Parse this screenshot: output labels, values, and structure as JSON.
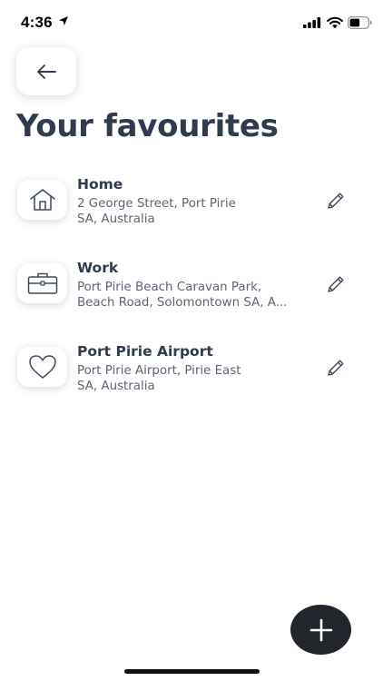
{
  "status_bar": {
    "time": "4:36"
  },
  "header": {
    "title": "Your favourites"
  },
  "favourites": [
    {
      "title": "Home",
      "icon": "home-icon",
      "address_lines": [
        "2 George Street, Port Pirie",
        "SA, Australia"
      ]
    },
    {
      "title": "Work",
      "icon": "briefcase-icon",
      "address_lines": [
        "Port Pirie Beach Caravan Park,",
        "Beach Road, Solomontown SA, A..."
      ]
    },
    {
      "title": "Port Pirie Airport",
      "icon": "heart-icon",
      "address_lines": [
        "Port Pirie Airport, Pirie East",
        "SA, Australia"
      ]
    }
  ],
  "colors": {
    "title_text": "#2f3b4f",
    "address_text": "#5c6675",
    "fab_background": "#22262c"
  }
}
